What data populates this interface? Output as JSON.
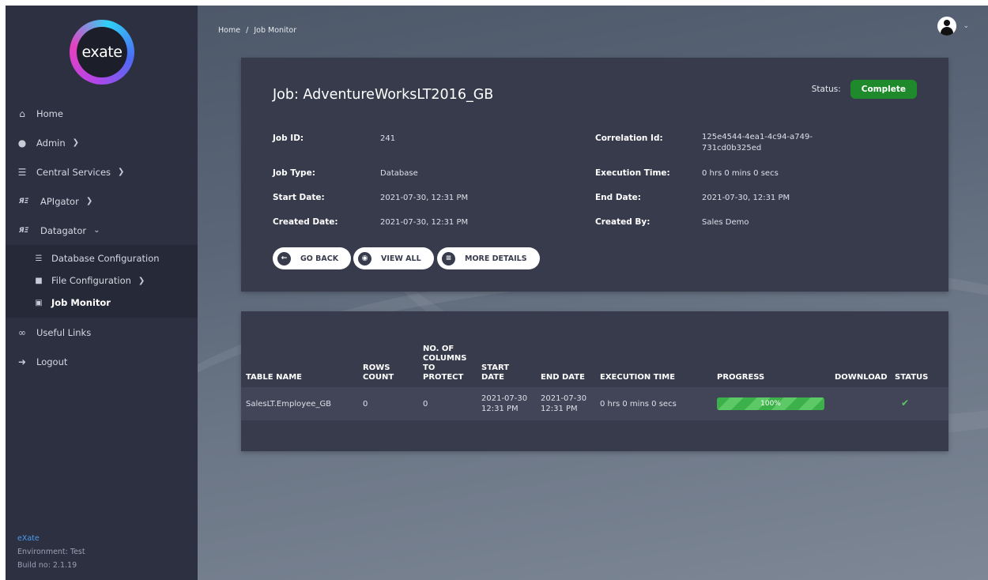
{
  "logo": {
    "text": "exate"
  },
  "sidebar": {
    "items": [
      {
        "label": "Home",
        "icon": "home-icon"
      },
      {
        "label": "Admin",
        "icon": "users-icon"
      },
      {
        "label": "Central Services",
        "icon": "layers-icon"
      },
      {
        "label": "APIgator",
        "icon": "apigator-icon"
      },
      {
        "label": "Datagator",
        "icon": "datagator-icon"
      }
    ],
    "subitems": [
      {
        "label": "Database Configuration",
        "icon": "database-icon"
      },
      {
        "label": "File Configuration",
        "icon": "file-icon"
      },
      {
        "label": "Job Monitor",
        "icon": "briefcase-icon"
      }
    ],
    "bottom_items": [
      {
        "label": "Useful Links",
        "icon": "link-icon"
      },
      {
        "label": "Logout",
        "icon": "logout-icon"
      }
    ],
    "footer": {
      "brand": "eXate",
      "environment": "Environment: Test",
      "build": "Build no: 2.1.19"
    }
  },
  "breadcrumb": {
    "home": "Home",
    "separator": "/",
    "current": "Job Monitor"
  },
  "job": {
    "title": "Job: AdventureWorksLT2016_GB",
    "status_label": "Status:",
    "status": "Complete",
    "fields": {
      "job_id": {
        "label": "Job ID:",
        "value": "241"
      },
      "correlation_id": {
        "label": "Correlation Id:",
        "value_line1": "125e4544-4ea1-4c94-a749-",
        "value_line2": "731cd0b325ed"
      },
      "job_type": {
        "label": "Job Type:",
        "value": "Database"
      },
      "execution_time": {
        "label": "Execution Time:",
        "value": "0 hrs 0 mins 0 secs"
      },
      "start_date": {
        "label": "Start Date:",
        "value": "2021-07-30, 12:31 PM"
      },
      "end_date": {
        "label": "End Date:",
        "value": "2021-07-30, 12:31 PM"
      },
      "created_date": {
        "label": "Created Date:",
        "value": "2021-07-30, 12:31 PM"
      },
      "created_by": {
        "label": "Created By:",
        "value": "Sales Demo"
      }
    },
    "buttons": {
      "go_back": "GO BACK",
      "view_all": "VIEW ALL",
      "more_details": "MORE DETAILS"
    }
  },
  "table": {
    "headers": {
      "table_name": "TABLE NAME",
      "rows_count_1": "ROWS",
      "rows_count_2": "COUNT",
      "cols_1": "NO. OF",
      "cols_2": "COLUMNS",
      "cols_3": "TO",
      "cols_4": "PROTECT",
      "start_date": "START DATE",
      "end_date": "END DATE",
      "execution_time": "EXECUTION TIME",
      "progress": "PROGRESS",
      "download": "DOWNLOAD",
      "status": "STATUS"
    },
    "rows": [
      {
        "table_name": "SalesLT.Employee_GB",
        "rows_count": "0",
        "columns_to_protect": "0",
        "start_date_1": "2021-07-30",
        "start_date_2": "12:31 PM",
        "end_date_1": "2021-07-30",
        "end_date_2": "12:31 PM",
        "execution_time": "0 hrs 0 mins 0 secs",
        "progress": 1.0,
        "progress_label": "100%",
        "status_icon": "check-icon"
      }
    ]
  },
  "colors": {
    "status_complete": "#1f8a2c",
    "progress": "#3cb14a",
    "sidebar": "#2d3040",
    "card": "#373b4c"
  }
}
